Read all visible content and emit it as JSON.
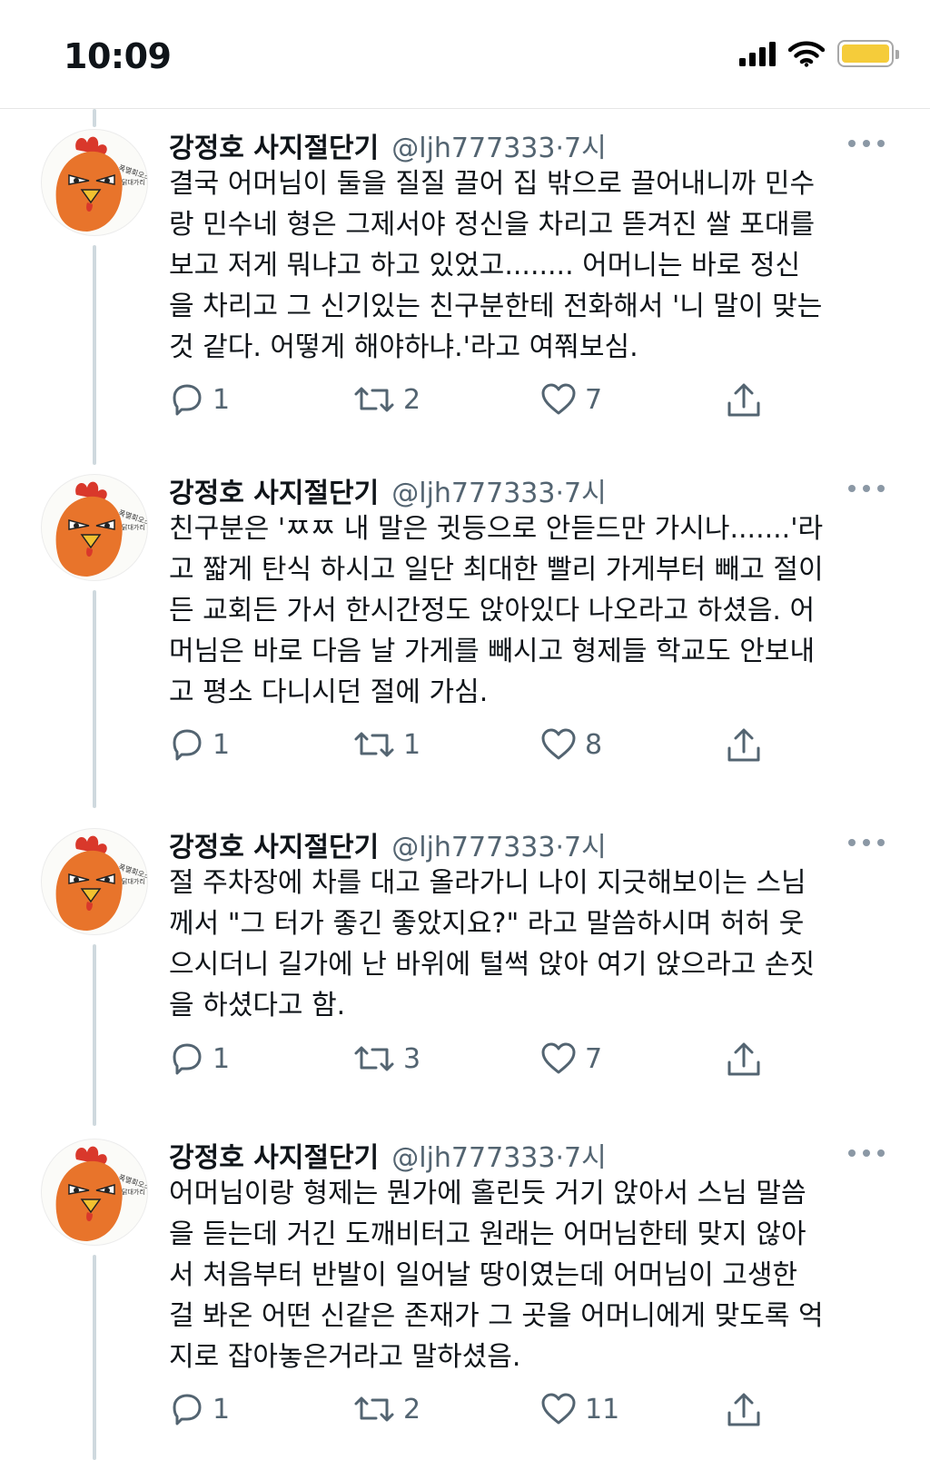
{
  "status_bar": {
    "time": "10:09"
  },
  "tweets": [
    {
      "author": "강정호 사지절단기",
      "handle": "@ljh777333",
      "meta_sep": " · ",
      "time": "7시",
      "text": "결국 어머님이 둘을 질질 끌어 집 밖으로 끌어내니까 민수\n랑 민수네 형은 그제서야 정신을 차리고 뜯겨진 쌀 포대를\n보고 저게 뭐냐고 하고 있었고........ 어머니는 바로 정신\n을 차리고 그 신기있는 친구분한테 전화해서 '니 말이 맞는\n것 같다. 어떻게 해야하냐.'라고 여쭤보심.",
      "replies": "1",
      "retweets": "2",
      "likes": "7"
    },
    {
      "author": "강정호 사지절단기",
      "handle": "@ljh777333",
      "meta_sep": " · ",
      "time": "7시",
      "text": "친구분은 'ㅉㅉ 내 말은 귓등으로 안듣드만 가시나.......'라\n고 짧게 탄식 하시고 일단 최대한 빨리 가게부터 빼고 절이\n든 교회든 가서 한시간정도 앉아있다 나오라고 하셨음. 어\n머님은 바로 다음 날 가게를 빼시고 형제들 학교도 안보내\n고 평소 다니시던 절에 가심.",
      "replies": "1",
      "retweets": "1",
      "likes": "8"
    },
    {
      "author": "강정호 사지절단기",
      "handle": "@ljh777333",
      "meta_sep": " · ",
      "time": "7시",
      "text": "절 주차장에 차를 대고 올라가니 나이 지긋해보이는 스님\n께서 \"그 터가 좋긴 좋았지요?\" 라고 말씀하시며 허허 웃\n으시더니 길가에 난 바위에 털썩 앉아 여기 앉으라고 손짓\n을 하셨다고 함.",
      "replies": "1",
      "retweets": "3",
      "likes": "7"
    },
    {
      "author": "강정호 사지절단기",
      "handle": "@ljh777333",
      "meta_sep": " · ",
      "time": "7시",
      "text": "어머님이랑 형제는 뭔가에 홀린듯 거기 앉아서 스님 말씀\n을 듣는데 거긴 도깨비터고 원래는 어머님한테 맞지 않아\n서 처음부터 반발이 일어날 땅이였는데 어머님이 고생한\n걸 봐온 어떤 신같은 존재가 그 곳을 어머니에게 맞도록 억\n지로 잡아놓은거라고 말하셨음.",
      "replies": "1",
      "retweets": "2",
      "likes": "11"
    }
  ]
}
